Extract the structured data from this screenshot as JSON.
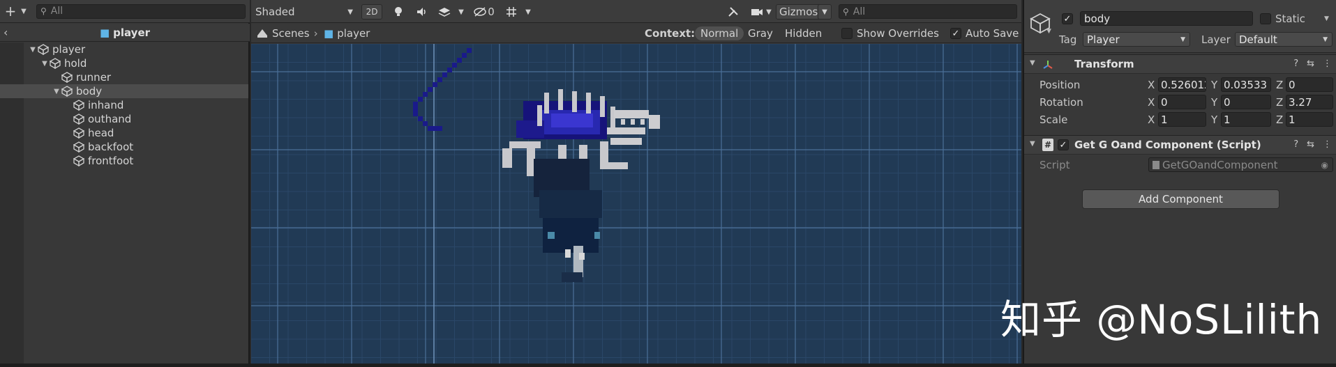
{
  "hierarchy": {
    "search_placeholder": "All",
    "breadcrumb": "player",
    "tree": [
      {
        "label": "player",
        "depth": 0,
        "expanded": true
      },
      {
        "label": "hold",
        "depth": 1,
        "expanded": true
      },
      {
        "label": "runner",
        "depth": 2,
        "expanded": false
      },
      {
        "label": "body",
        "depth": 2,
        "expanded": true,
        "selected": true
      },
      {
        "label": "inhand",
        "depth": 3,
        "expanded": false
      },
      {
        "label": "outhand",
        "depth": 3,
        "expanded": false
      },
      {
        "label": "head",
        "depth": 3,
        "expanded": false
      },
      {
        "label": "backfoot",
        "depth": 3,
        "expanded": false
      },
      {
        "label": "frontfoot",
        "depth": 3,
        "expanded": false
      }
    ]
  },
  "scene": {
    "shading_mode": "Shaded",
    "mode_2d": "2D",
    "hidden_count": "0",
    "gizmos": "Gizmos",
    "search_placeholder": "All",
    "breadcrumb_root": "Scenes",
    "breadcrumb_current": "player",
    "context_label": "Context:",
    "context_options": [
      "Normal",
      "Gray",
      "Hidden"
    ],
    "show_overrides": "Show Overrides",
    "auto_save": "Auto Save",
    "auto_save_checked": true
  },
  "inspector": {
    "object_name": "body",
    "static_label": "Static",
    "tag_label": "Tag",
    "tag_value": "Player",
    "layer_label": "Layer",
    "layer_value": "Default",
    "transform": {
      "title": "Transform",
      "position_label": "Position",
      "rotation_label": "Rotation",
      "scale_label": "Scale",
      "position": {
        "x": "0.526012",
        "y": "0.03533",
        "z": "0"
      },
      "rotation": {
        "x": "0",
        "y": "0",
        "z": "3.27"
      },
      "scale": {
        "x": "1",
        "y": "1",
        "z": "1"
      }
    },
    "script_component": {
      "title": "Get G Oand Component (Script)",
      "script_label": "Script",
      "script_value": "GetGOandComponent"
    },
    "add_component": "Add Component"
  },
  "watermark": "知乎 @NoSLilith",
  "colors": {
    "viewport_bg": "#213a55",
    "selection": "#4c4c4c",
    "cube_icon": "#5fb4e6"
  }
}
